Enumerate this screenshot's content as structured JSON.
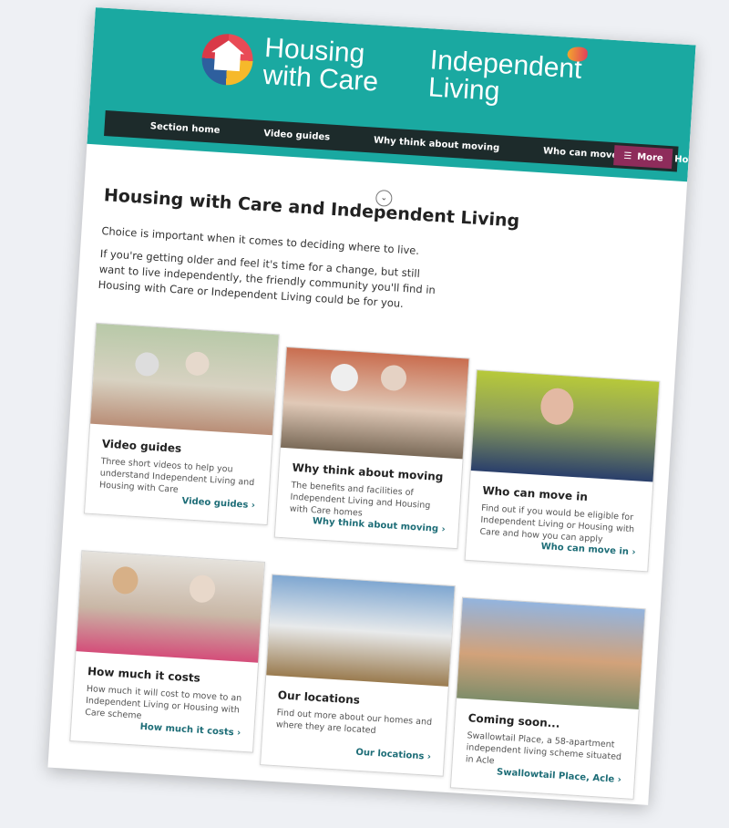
{
  "header": {
    "logo_left_line1": "Housing",
    "logo_left_line2": "with Care",
    "logo_right_line1": "Independent",
    "logo_right_line2": "Living"
  },
  "nav": {
    "items": [
      "Section home",
      "Video guides",
      "Why think about moving",
      "Who can move in",
      "How much it costs"
    ],
    "more_label": "More"
  },
  "page": {
    "title": "Housing with Care and Independent Living",
    "intro_1": "Choice is important when it comes to deciding where to live.",
    "intro_2": "If you're getting older and feel it's time for a change, but still want to live independently, the friendly community you'll find in Housing with Care or Independent Living could be for you."
  },
  "cards": [
    {
      "title": "Video guides",
      "desc": "Three short videos to help you understand Independent Living and Housing with Care",
      "link": "Video guides"
    },
    {
      "title": "Why think about moving",
      "desc": "The benefits and facilities of Independent Living and Housing with Care homes",
      "link": "Why think about moving"
    },
    {
      "title": "Who can move in",
      "desc": "Find out if you would be eligible for Independent Living or Housing with Care and how you can apply",
      "link": "Who can move in"
    },
    {
      "title": "How much it costs",
      "desc": "How much it will cost to move to an Independent Living or Housing with Care scheme",
      "link": "How much it costs"
    },
    {
      "title": "Our locations",
      "desc": "Find out more about our homes and where they are located",
      "link": "Our locations"
    },
    {
      "title": "Coming soon...",
      "desc": "Swallowtail Place, a 58-apartment independent living scheme situated in Acle",
      "link": "Swallowtail Place, Acle"
    }
  ],
  "colors": {
    "banner": "#1aa9a1",
    "nav": "#1d2b2b",
    "more_button": "#8e2c5b",
    "link": "#1d6d77"
  }
}
